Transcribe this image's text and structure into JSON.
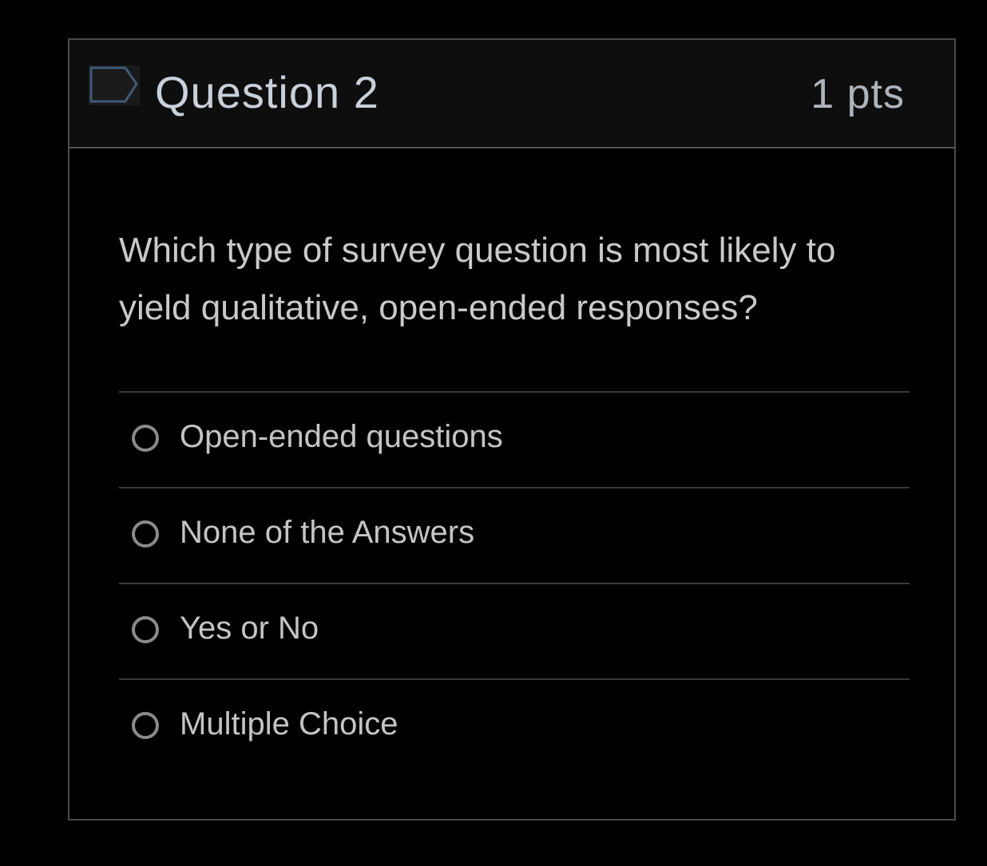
{
  "question": {
    "title": "Question 2",
    "points": "1 pts",
    "flag_icon": "flag-bookmark-icon",
    "text": "Which type of survey question is most likely to yield qualitative, open-ended responses?"
  },
  "answers": [
    {
      "label": "Open-ended questions",
      "selected": false
    },
    {
      "label": "None of the Answers",
      "selected": false
    },
    {
      "label": "Yes or No",
      "selected": false
    },
    {
      "label": "Multiple Choice",
      "selected": false
    }
  ],
  "colors": {
    "background": "#000000",
    "header_background": "#0e0e0e",
    "border": "#4a4a4a",
    "title_text": "#c8d0da",
    "body_text": "#c9c9c9",
    "radio_outline": "#8a8a8a"
  }
}
